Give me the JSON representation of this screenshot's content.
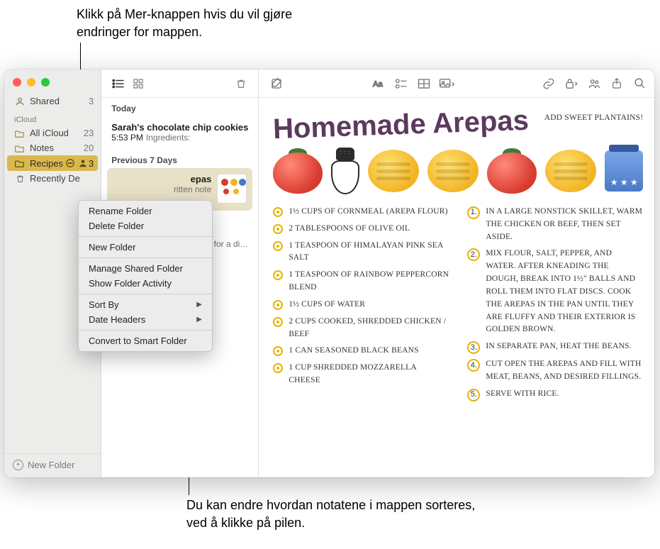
{
  "callouts": {
    "top": "Klikk på Mer-knappen hvis du vil gjøre endringer for mappen.",
    "bottom": "Du kan endre hvordan notatene i mappen sorteres, ved å klikke på pilen."
  },
  "sidebar": {
    "shared": {
      "icon": "person-icon",
      "label": "Shared",
      "count": "3"
    },
    "section": "iCloud",
    "items": [
      {
        "icon": "folder-icon",
        "label": "All iCloud",
        "count": "23"
      },
      {
        "icon": "folder-icon",
        "label": "Notes",
        "count": "20"
      },
      {
        "icon": "folder-icon",
        "label": "Recipes",
        "count": "3",
        "selected": true,
        "shared": true
      },
      {
        "icon": "trash-icon",
        "label": "Recently De",
        "count": ""
      }
    ],
    "footer": "New Folder"
  },
  "notes_list": {
    "sections": [
      {
        "header": "Today",
        "items": [
          {
            "title": "Sarah's chocolate chip cookies",
            "time": "5:53 PM",
            "preview": "Ingredients:"
          }
        ]
      },
      {
        "header": "Previous 7 Days",
        "items": [
          {
            "title": "epas",
            "preview": "ritten note",
            "selected": true,
            "thumb": true
          },
          {
            "title_hidden": "",
            "preview": "cken piccata for a di…"
          }
        ]
      }
    ]
  },
  "context_menu": [
    "Rename Folder",
    "Delete Folder",
    "---",
    "New Folder",
    "---",
    "Manage Shared Folder",
    "Show Folder Activity",
    "---",
    "Sort By>",
    "Date Headers>",
    "---",
    "Convert to Smart Folder"
  ],
  "note": {
    "title": "Homemade Arepas",
    "annotation": "ADD SWEET PLANTAINS!",
    "ingredients": [
      "1½ cups of cornmeal (arepa flour)",
      "2 tablespoons of olive oil",
      "1 teaspoon of Himalayan pink sea salt",
      "1 teaspoon of rainbow peppercorn blend",
      "1½ cups of water",
      "2 cups cooked, shredded chicken / beef",
      "1 can seasoned black beans",
      "1 cup shredded mozzarella cheese"
    ],
    "steps": [
      "In a large nonstick skillet, warm the chicken or beef, then set aside.",
      "Mix flour, salt, pepper, and water. After kneading the dough, break into 1½\" balls and roll them into flat discs. Cook the arepas in the pan until they are fluffy and their exterior is golden brown.",
      "In separate pan, heat the beans.",
      "Cut open the arepas and fill with meat, beans, and desired fillings.",
      "Serve with rice."
    ]
  }
}
